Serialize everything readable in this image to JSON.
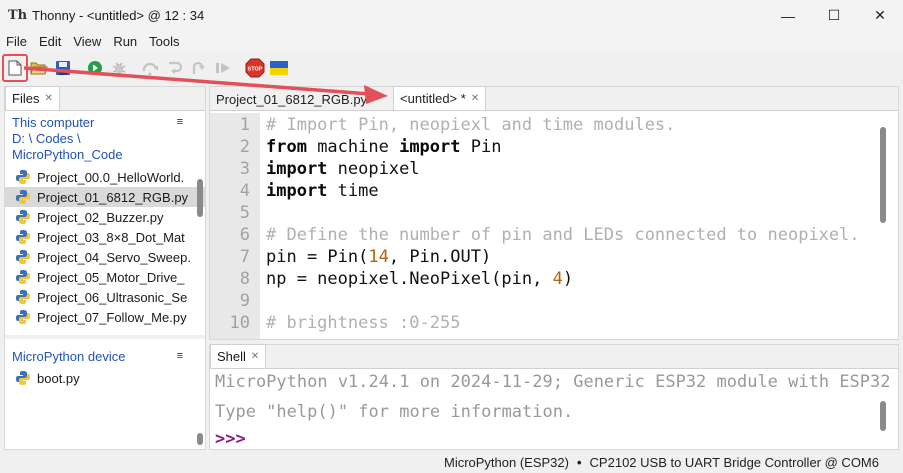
{
  "window": {
    "title": "Thonny  -  <untitled>  @  12 : 34",
    "logo_glyph": "Th",
    "controls": {
      "minimize": "—",
      "maximize": "☐",
      "close": "✕"
    }
  },
  "menu": [
    "File",
    "Edit",
    "View",
    "Run",
    "Tools"
  ],
  "toolbar": {
    "buttons": [
      "new-file",
      "open-file",
      "save",
      "run",
      "debug",
      "step-over",
      "step-into",
      "step-out",
      "resume",
      "stop",
      "ukraine-flag"
    ],
    "stop_label": "STOP"
  },
  "files": {
    "tab_label": "Files",
    "computer_header": [
      "This computer",
      "D: \\ Codes \\",
      "MicroPython_Code"
    ],
    "computer_files": [
      "Project_00.0_HelloWorld.",
      "Project_01_6812_RGB.py",
      "Project_02_Buzzer.py",
      "Project_03_8×8_Dot_Mat",
      "Project_04_Servo_Sweep.",
      "Project_05_Motor_Drive_",
      "Project_06_Ultrasonic_Se",
      "Project_07_Follow_Me.py"
    ],
    "selected_index": 1,
    "device_header": "MicroPython device",
    "device_files": [
      "boot.py"
    ]
  },
  "editor": {
    "tabs": [
      {
        "label": "Project_01_6812_RGB.py",
        "active": false
      },
      {
        "label": "<untitled> *",
        "active": true
      }
    ],
    "lines": [
      {
        "n": "1",
        "tokens": [
          {
            "t": "# Import Pin, neopiexl and time modules.",
            "c": "comment"
          }
        ]
      },
      {
        "n": "2",
        "tokens": [
          {
            "t": "from",
            "c": "kw"
          },
          {
            "t": " machine ",
            "c": "plain"
          },
          {
            "t": "import",
            "c": "kw"
          },
          {
            "t": " Pin",
            "c": "plain"
          }
        ]
      },
      {
        "n": "3",
        "tokens": [
          {
            "t": "import",
            "c": "kw"
          },
          {
            "t": " neopixel",
            "c": "plain"
          }
        ]
      },
      {
        "n": "4",
        "tokens": [
          {
            "t": "import",
            "c": "kw"
          },
          {
            "t": " time",
            "c": "plain"
          }
        ]
      },
      {
        "n": "5",
        "tokens": []
      },
      {
        "n": "6",
        "tokens": [
          {
            "t": "# Define the number of pin and LEDs connected to neopixel.",
            "c": "comment"
          }
        ]
      },
      {
        "n": "7",
        "tokens": [
          {
            "t": "pin = Pin(",
            "c": "plain"
          },
          {
            "t": "14",
            "c": "num"
          },
          {
            "t": ", Pin.OUT)",
            "c": "plain"
          }
        ]
      },
      {
        "n": "8",
        "tokens": [
          {
            "t": "np = neopixel.NeoPixel(pin, ",
            "c": "plain"
          },
          {
            "t": "4",
            "c": "num"
          },
          {
            "t": ")",
            "c": "plain"
          }
        ]
      },
      {
        "n": "9",
        "tokens": []
      },
      {
        "n": "10",
        "tokens": [
          {
            "t": "# brightness :0-255",
            "c": "comment"
          }
        ]
      }
    ]
  },
  "shell": {
    "tab_label": "Shell",
    "lines": [
      "MicroPython v1.24.1 on 2024-11-29; Generic ESP32 module with ESP32",
      "Type \"help()\" for more information."
    ],
    "prompt": ">>>"
  },
  "status": {
    "interpreter": "MicroPython (ESP32)",
    "separator": "•",
    "port": "CP2102 USB to UART Bridge Controller @ COM6"
  },
  "colors": {
    "accent_link": "#2053b4",
    "annotation": "#e2505a",
    "prompt": "#8b1b7f"
  }
}
